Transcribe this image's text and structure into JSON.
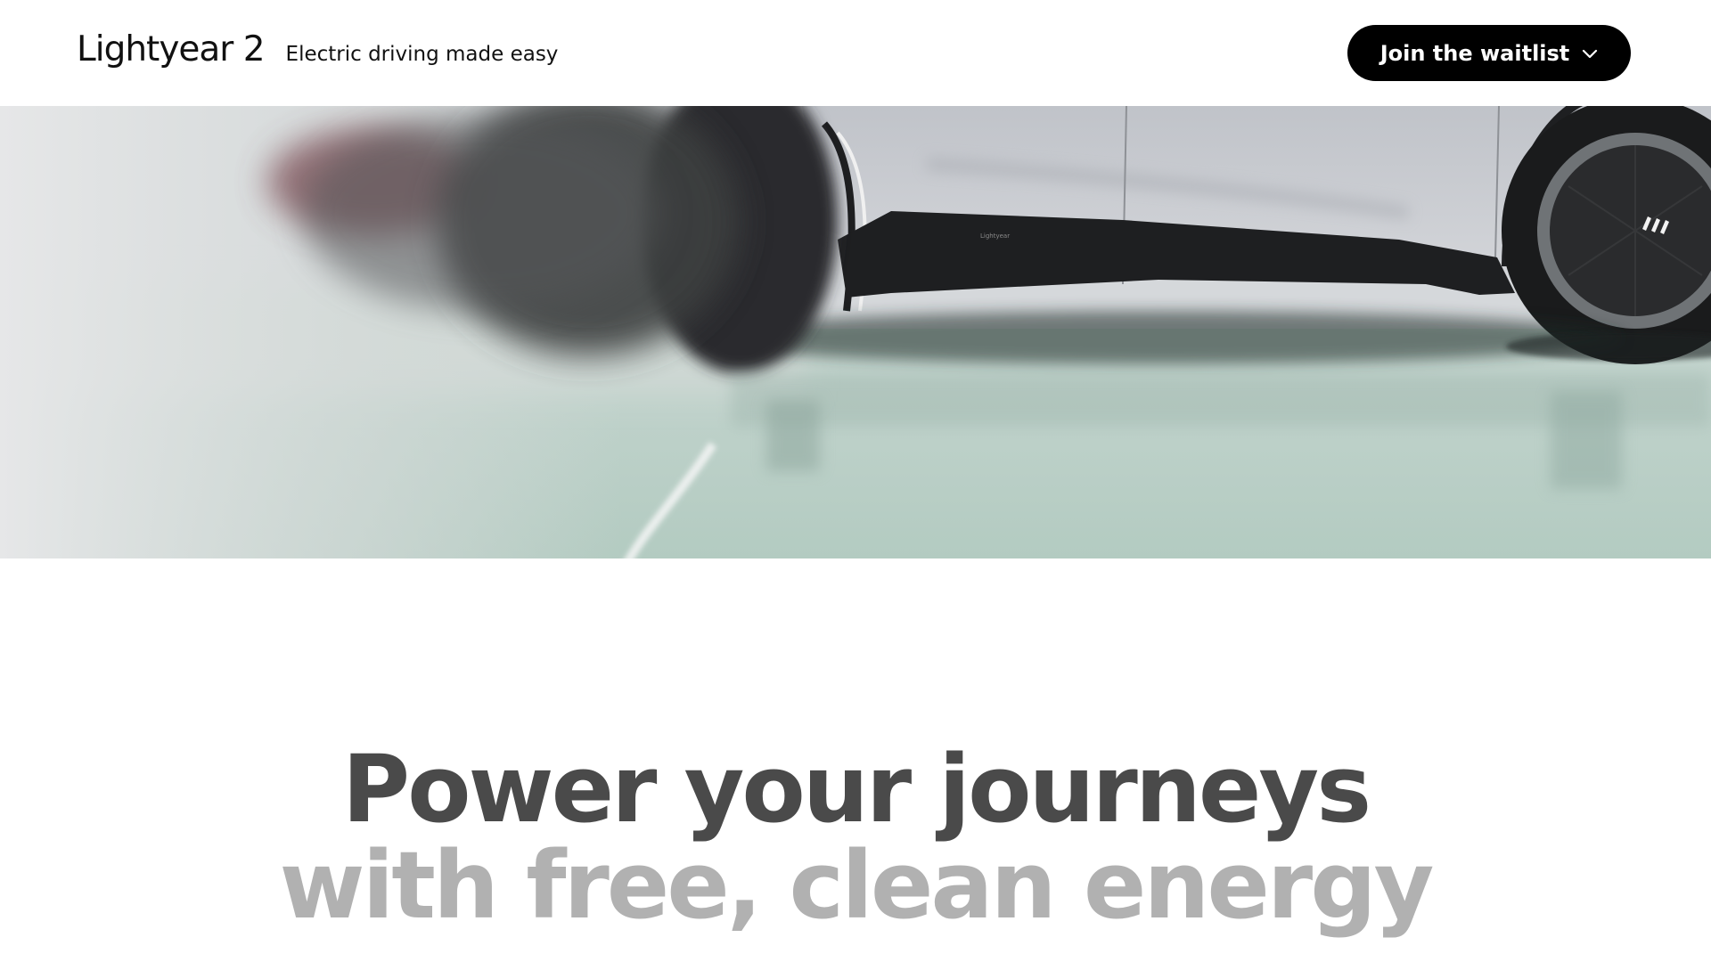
{
  "header": {
    "brand_name": "Lightyear 2",
    "tagline": "Electric driving made easy",
    "cta_label": "Join the waitlist",
    "cta_icon": "chevron-down-icon"
  },
  "hero": {
    "image_alt": "Lightyear 2 car parked on a reflective mint-green floor with a charging cable in the foreground",
    "colors": {
      "floor": "#b5cdc3",
      "car_body": "#c9cbd0",
      "car_trim": "#1e1f21"
    }
  },
  "headline": {
    "line1": "Power your journeys",
    "line2": "with free, clean energy",
    "line1_color": "#4a4a4a",
    "line2_color": "#b1b1b1"
  }
}
